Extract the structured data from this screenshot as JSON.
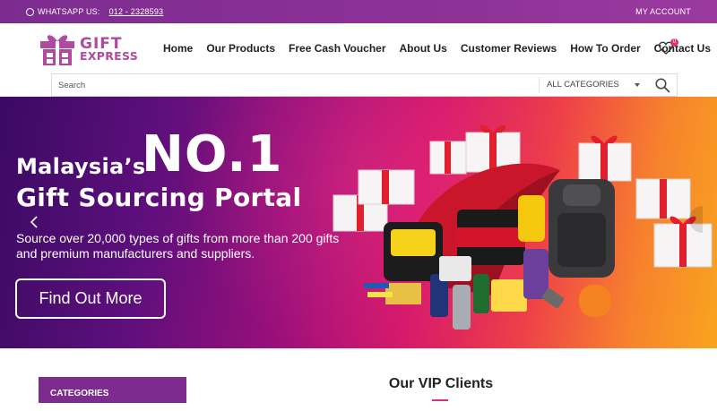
{
  "topbar": {
    "whatsapp_label": "WHATSAPP US:",
    "whatsapp_number": "012 - 2328593",
    "account": "MY ACCOUNT"
  },
  "logo": {
    "line1": "GIFT",
    "line2": "EXPRESS"
  },
  "nav": [
    "Home",
    "Our Products",
    "Free Cash Voucher",
    "About Us",
    "Customer Reviews",
    "How To Order",
    "Contact Us"
  ],
  "wishlist": {
    "count": "0"
  },
  "search": {
    "placeholder": "Search",
    "category": "ALL CATEGORIES"
  },
  "hero": {
    "line1": "Malaysia’s",
    "no1": "NO.1",
    "line2": "Gift Sourcing Portal",
    "subtitle": "Source over 20,000 types of gifts from more than 200 gifts and premium manufacturers and suppliers.",
    "cta": "Find Out More"
  },
  "sidebar": {
    "categories_title": "CATEGORIES"
  },
  "vip": {
    "title": "Our VIP Clients"
  },
  "colors": {
    "brand_purple": "#7d2b8f",
    "brand_pink": "#d6337d",
    "logo_pink": "#b04a9e"
  }
}
